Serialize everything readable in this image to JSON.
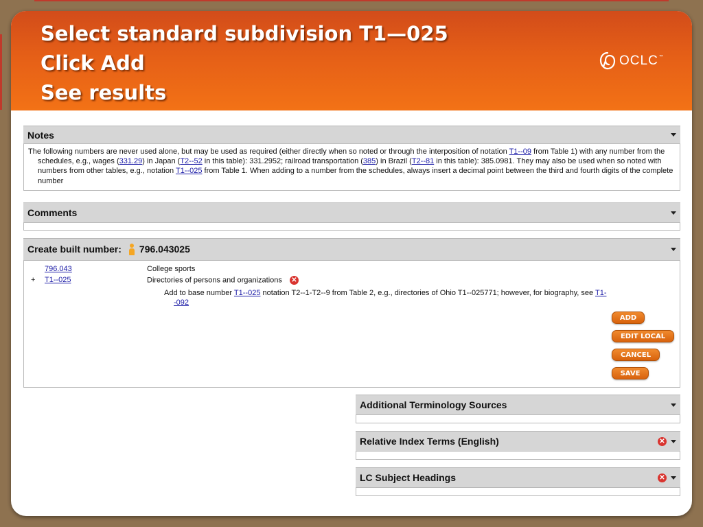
{
  "slide": {
    "title_lines": [
      "Select standard subdivision T1—025",
      "Click Add",
      "See results"
    ],
    "logo_text": "OCLC",
    "logo_tm": "™"
  },
  "notes": {
    "header": "Notes",
    "para_1": "The following numbers are never used alone, but may be used as required (either directly when so noted or through the interposition of notation ",
    "link_1": "T1--09",
    "para_2": " from Table 1) with any number from the schedules, e.g., wages (",
    "link_2": "331.29",
    "para_3": ") in Japan (",
    "link_3": "T2--52",
    "para_4": " in this table): 331.2952; railroad transportation (",
    "link_4": "385",
    "para_5": ") in Brazil (",
    "link_5": "T2--81",
    "para_6": " in this table): 385.0981. They may also be used when so noted with numbers from other tables, e.g., notation ",
    "link_6": "T1--025",
    "para_7": " from Table 1. When adding to a number from the schedules, always insert a decimal point between the third and fourth digits of the complete number"
  },
  "comments": {
    "header": "Comments"
  },
  "built_number": {
    "header_label": "Create built number:",
    "value": "796.043025",
    "rows": [
      {
        "prefix": "",
        "link": "796.043",
        "caption": "College sports"
      },
      {
        "prefix": "+",
        "link": "T1--025",
        "caption": "Directories of persons and organizations"
      }
    ],
    "instruction_pre": "Add to base number ",
    "instruction_link": "T1--025",
    "instruction_mid": " notation T2--1-T2--9 from Table 2, e.g., directories of Ohio T1--025771; however, for biography, see ",
    "instruction_link_end_1": "T1-",
    "instruction_link_end_2": "-092",
    "buttons": {
      "add": "ADD",
      "edit_local": "EDIT LOCAL",
      "cancel": "CANCEL",
      "save": "SAVE"
    }
  },
  "side_panels": {
    "additional_terminology": "Additional Terminology Sources",
    "relative_index": "Relative Index Terms (English)",
    "lc_subject": "LC Subject Headings"
  },
  "colors": {
    "header_orange": "#f37216",
    "header_dark_orange": "#d24c1a",
    "button_orange": "#e3711d",
    "panel_header_gray": "#d6d6d6",
    "link_blue": "#1a1aa6",
    "remove_red": "#d9342f",
    "frame_brown": "#8e7250"
  },
  "icons": {
    "caret": "chevron-down-icon",
    "remove": "remove-icon",
    "person": "person-icon",
    "logo": "oclc-logo-icon"
  }
}
